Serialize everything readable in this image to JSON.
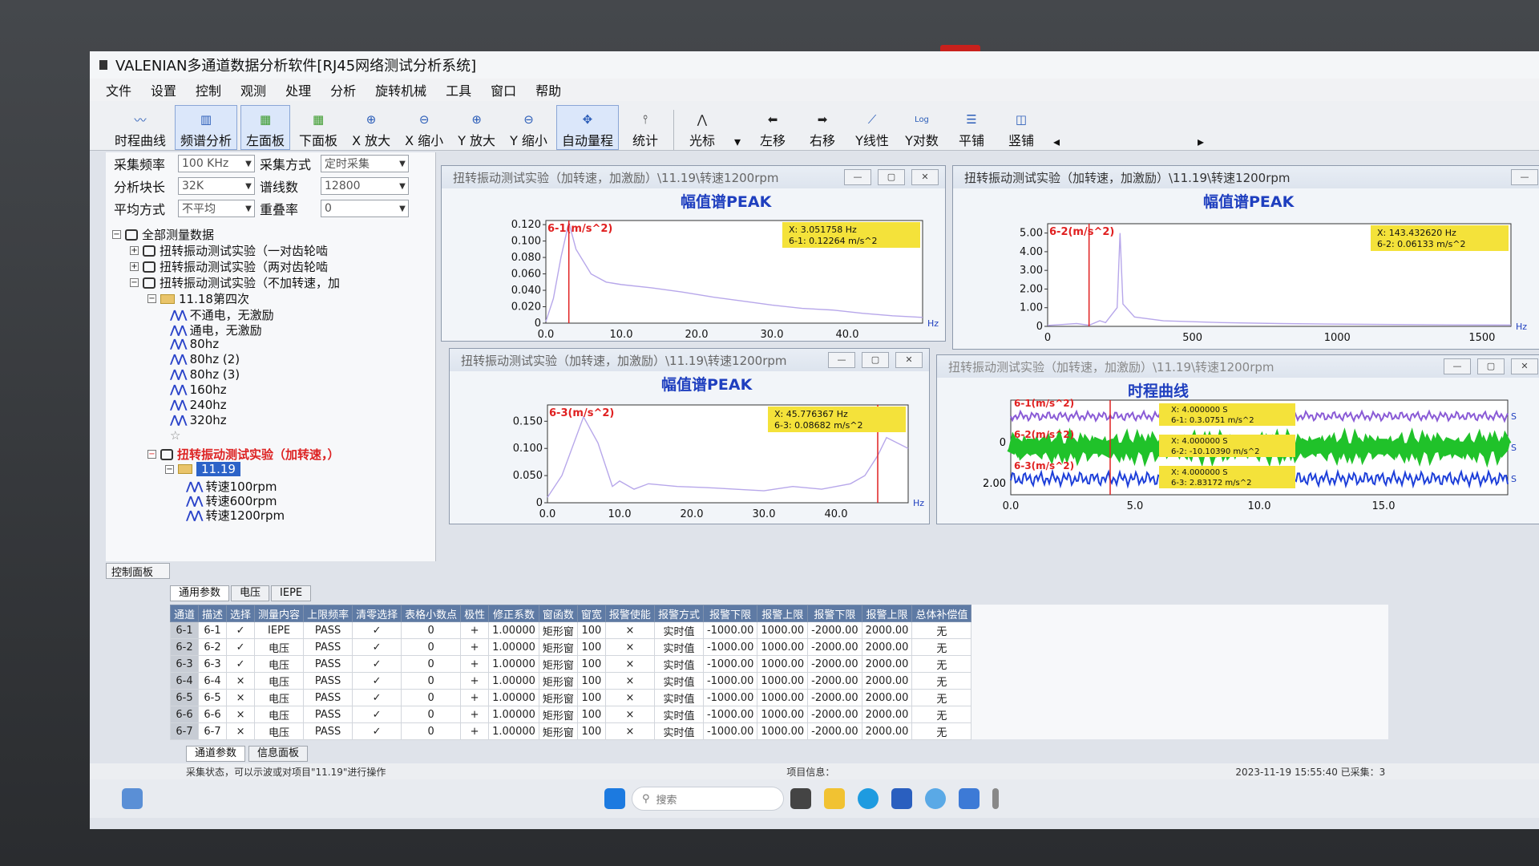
{
  "app": {
    "title": "VALENIAN多通道数据分析软件[RJ45网络测试分析系统]"
  },
  "menu": [
    "文件",
    "设置",
    "控制",
    "观测",
    "处理",
    "分析",
    "旋转机械",
    "工具",
    "窗口",
    "帮助"
  ],
  "toolbar": [
    "时程曲线",
    "频谱分析",
    "左面板",
    "下面板",
    "X 放大",
    "X 缩小",
    "Y 放大",
    "Y 缩小",
    "自动量程",
    "统计",
    "光标",
    "左移",
    "右移",
    "Y线性",
    "Y对数",
    "平铺",
    "竖铺"
  ],
  "params": {
    "sample_rate_label": "采集频率",
    "sample_rate": "100 KHz",
    "sample_mode_label": "采集方式",
    "sample_mode": "定时采集",
    "block_label": "分析块长",
    "block": "32K",
    "lines_label": "谱线数",
    "lines": "12800",
    "avg_label": "平均方式",
    "avg": "不平均",
    "overlap_label": "重叠率",
    "overlap": "0"
  },
  "tree": {
    "root": "全部测量数据",
    "exp1": "扭转振动测试实验（一对齿轮啮",
    "exp2": "扭转振动测试实验（两对齿轮啮",
    "exp3": "扭转振动测试实验（不加转速，加",
    "folder1": "11.18第四次",
    "items1": [
      "不通电，无激励",
      "通电，无激励",
      "80hz",
      "80hz (2)",
      "80hz (3)",
      "160hz",
      "240hz",
      "320hz"
    ],
    "exp4": "扭转振动测试实验（加转速，）",
    "folder2": "11.19",
    "items2": [
      "转速100rpm",
      "转速600rpm",
      "转速1200rpm"
    ]
  },
  "control_panel_tab": "控制面板",
  "windows": {
    "w1": {
      "title": "扭转振动测试实验（加转速，加激励）\\11.19\\转速1200rpm",
      "chart_title": "幅值谱PEAK",
      "series": "6-1(m/s^2)",
      "cursor_x": "X: 3.051758 Hz",
      "cursor_y": "6-1: 0.12264 m/s^2",
      "unit": "Hz"
    },
    "w2": {
      "title": "扭转振动测试实验（加转速，加激励）\\11.19\\转速1200rpm",
      "chart_title": "幅值谱PEAK",
      "series": "6-2(m/s^2)",
      "cursor_x": "X: 143.432620 Hz",
      "cursor_y": "6-2: 0.06133 m/s^2",
      "unit": "Hz"
    },
    "w3": {
      "title": "扭转振动测试实验（加转速，加激励）\\11.19\\转速1200rpm",
      "chart_title": "幅值谱PEAK",
      "series": "6-3(m/s^2)",
      "cursor_x": "X: 45.776367 Hz",
      "cursor_y": "6-3: 0.08682 m/s^2",
      "unit": "Hz"
    },
    "w4": {
      "title": "扭转振动测试实验（加转速，加激励）\\11.19\\转速1200rpm",
      "chart_title": "时程曲线",
      "s1": "6-1(m/s^2)",
      "s2": "6-2(m/s^2)",
      "s3": "6-3(m/s^2)",
      "c1x": "X: 4.000000 S",
      "c1y": "6-1: 0.3.0751 m/s^2",
      "c2x": "X: 4.000000 S",
      "c2y": "6-2: -10.10390 m/s^2",
      "c3x": "X: 4.000000 S",
      "c3y": "6-3: 2.83172 m/s^2",
      "unit": "S"
    }
  },
  "chart_data": [
    {
      "type": "line",
      "title": "幅值谱PEAK",
      "xlabel": "Hz",
      "ylabel": "6-1(m/s^2)",
      "xlim": [
        0,
        50
      ],
      "ylim": [
        0,
        0.125
      ],
      "xticks": [
        "0.0",
        "10.0",
        "20.0",
        "30.0",
        "40.0"
      ],
      "yticks": [
        "0",
        "0.020",
        "0.040",
        "0.060",
        "0.080",
        "0.100",
        "0.120"
      ],
      "x": [
        0,
        1,
        2,
        3.05,
        4,
        6,
        8,
        10,
        14,
        18,
        22,
        26,
        30,
        34,
        38,
        42,
        46,
        50
      ],
      "y": [
        0.002,
        0.03,
        0.08,
        0.12264,
        0.09,
        0.06,
        0.05,
        0.047,
        0.043,
        0.038,
        0.032,
        0.027,
        0.022,
        0.018,
        0.016,
        0.012,
        0.009,
        0.007
      ]
    },
    {
      "type": "line",
      "title": "幅值谱PEAK",
      "xlabel": "Hz",
      "ylabel": "6-2(m/s^2)",
      "xlim": [
        0,
        1600
      ],
      "ylim": [
        0,
        5.5
      ],
      "xticks": [
        "0",
        "500",
        "1000",
        "1500"
      ],
      "yticks": [
        "0",
        "1.00",
        "2.00",
        "3.00",
        "4.00",
        "5.00"
      ],
      "x": [
        0,
        50,
        100,
        143,
        180,
        200,
        240,
        250,
        260,
        300,
        400,
        600,
        800,
        1000,
        1200,
        1400,
        1600
      ],
      "y": [
        0.05,
        0.1,
        0.15,
        0.06,
        0.3,
        0.2,
        1.0,
        5.0,
        1.2,
        0.5,
        0.3,
        0.2,
        0.15,
        0.12,
        0.1,
        0.08,
        0.07
      ]
    },
    {
      "type": "line",
      "title": "幅值谱PEAK",
      "xlabel": "Hz",
      "ylabel": "6-3(m/s^2)",
      "xlim": [
        0,
        50
      ],
      "ylim": [
        0,
        0.18
      ],
      "xticks": [
        "0.0",
        "10.0",
        "20.0",
        "30.0",
        "40.0"
      ],
      "yticks": [
        "0",
        "0.050",
        "0.100",
        "0.150"
      ],
      "x": [
        0,
        2,
        5,
        7,
        9,
        10,
        12,
        14,
        18,
        22,
        26,
        30,
        34,
        38,
        42,
        44,
        45.78,
        47,
        50
      ],
      "y": [
        0.01,
        0.05,
        0.158,
        0.11,
        0.03,
        0.04,
        0.025,
        0.035,
        0.03,
        0.028,
        0.025,
        0.022,
        0.03,
        0.025,
        0.035,
        0.05,
        0.08682,
        0.12,
        0.1
      ]
    },
    {
      "type": "line",
      "title": "时程曲线",
      "xlabel": "S",
      "xlim": [
        0,
        20
      ],
      "xticks": [
        "0.0",
        "5.0",
        "10.0",
        "15.0"
      ],
      "yticks": [
        "0",
        "2.00"
      ],
      "series": [
        {
          "name": "6-1(m/s^2)",
          "color": "#8a5bd6"
        },
        {
          "name": "6-2(m/s^2)",
          "color": "#20c22a"
        },
        {
          "name": "6-3(m/s^2)",
          "color": "#1d3fd9"
        }
      ]
    }
  ],
  "tabs": [
    "通用参数",
    "电压",
    "IEPE"
  ],
  "grid": {
    "headers": [
      "通道",
      "描述",
      "选择",
      "测量内容",
      "上限频率",
      "清零选择",
      "表格小数点",
      "极性",
      "修正系数",
      "窗函数",
      "窗宽",
      "报警使能",
      "报警方式",
      "报警下限",
      "报警上限",
      "报警下限",
      "报警上限",
      "总体补偿值"
    ],
    "rows": [
      [
        "6-1",
        "6-1",
        "✓",
        "IEPE",
        "PASS",
        "✓",
        "0",
        "+",
        "1.00000",
        "矩形窗",
        "100",
        "×",
        "实时值",
        "-1000.00",
        "1000.00",
        "-2000.00",
        "2000.00",
        "无"
      ],
      [
        "6-2",
        "6-2",
        "✓",
        "电压",
        "PASS",
        "✓",
        "0",
        "+",
        "1.00000",
        "矩形窗",
        "100",
        "×",
        "实时值",
        "-1000.00",
        "1000.00",
        "-2000.00",
        "2000.00",
        "无"
      ],
      [
        "6-3",
        "6-3",
        "✓",
        "电压",
        "PASS",
        "✓",
        "0",
        "+",
        "1.00000",
        "矩形窗",
        "100",
        "×",
        "实时值",
        "-1000.00",
        "1000.00",
        "-2000.00",
        "2000.00",
        "无"
      ],
      [
        "6-4",
        "6-4",
        "×",
        "电压",
        "PASS",
        "✓",
        "0",
        "+",
        "1.00000",
        "矩形窗",
        "100",
        "×",
        "实时值",
        "-1000.00",
        "1000.00",
        "-2000.00",
        "2000.00",
        "无"
      ],
      [
        "6-5",
        "6-5",
        "×",
        "电压",
        "PASS",
        "✓",
        "0",
        "+",
        "1.00000",
        "矩形窗",
        "100",
        "×",
        "实时值",
        "-1000.00",
        "1000.00",
        "-2000.00",
        "2000.00",
        "无"
      ],
      [
        "6-6",
        "6-6",
        "×",
        "电压",
        "PASS",
        "✓",
        "0",
        "+",
        "1.00000",
        "矩形窗",
        "100",
        "×",
        "实时值",
        "-1000.00",
        "1000.00",
        "-2000.00",
        "2000.00",
        "无"
      ],
      [
        "6-7",
        "6-7",
        "×",
        "电压",
        "PASS",
        "✓",
        "0",
        "+",
        "1.00000",
        "矩形窗",
        "100",
        "×",
        "实时值",
        "-1000.00",
        "1000.00",
        "-2000.00",
        "2000.00",
        "无"
      ]
    ]
  },
  "subtabs": [
    "通道参数",
    "信息面板"
  ],
  "status": {
    "left": "采集状态，可以示波或对项目\"11.19\"进行操作",
    "mid": "项目信息：",
    "right": "2023-11-19 15:55:40  已采集：3"
  },
  "taskbar": {
    "search": "搜索"
  }
}
